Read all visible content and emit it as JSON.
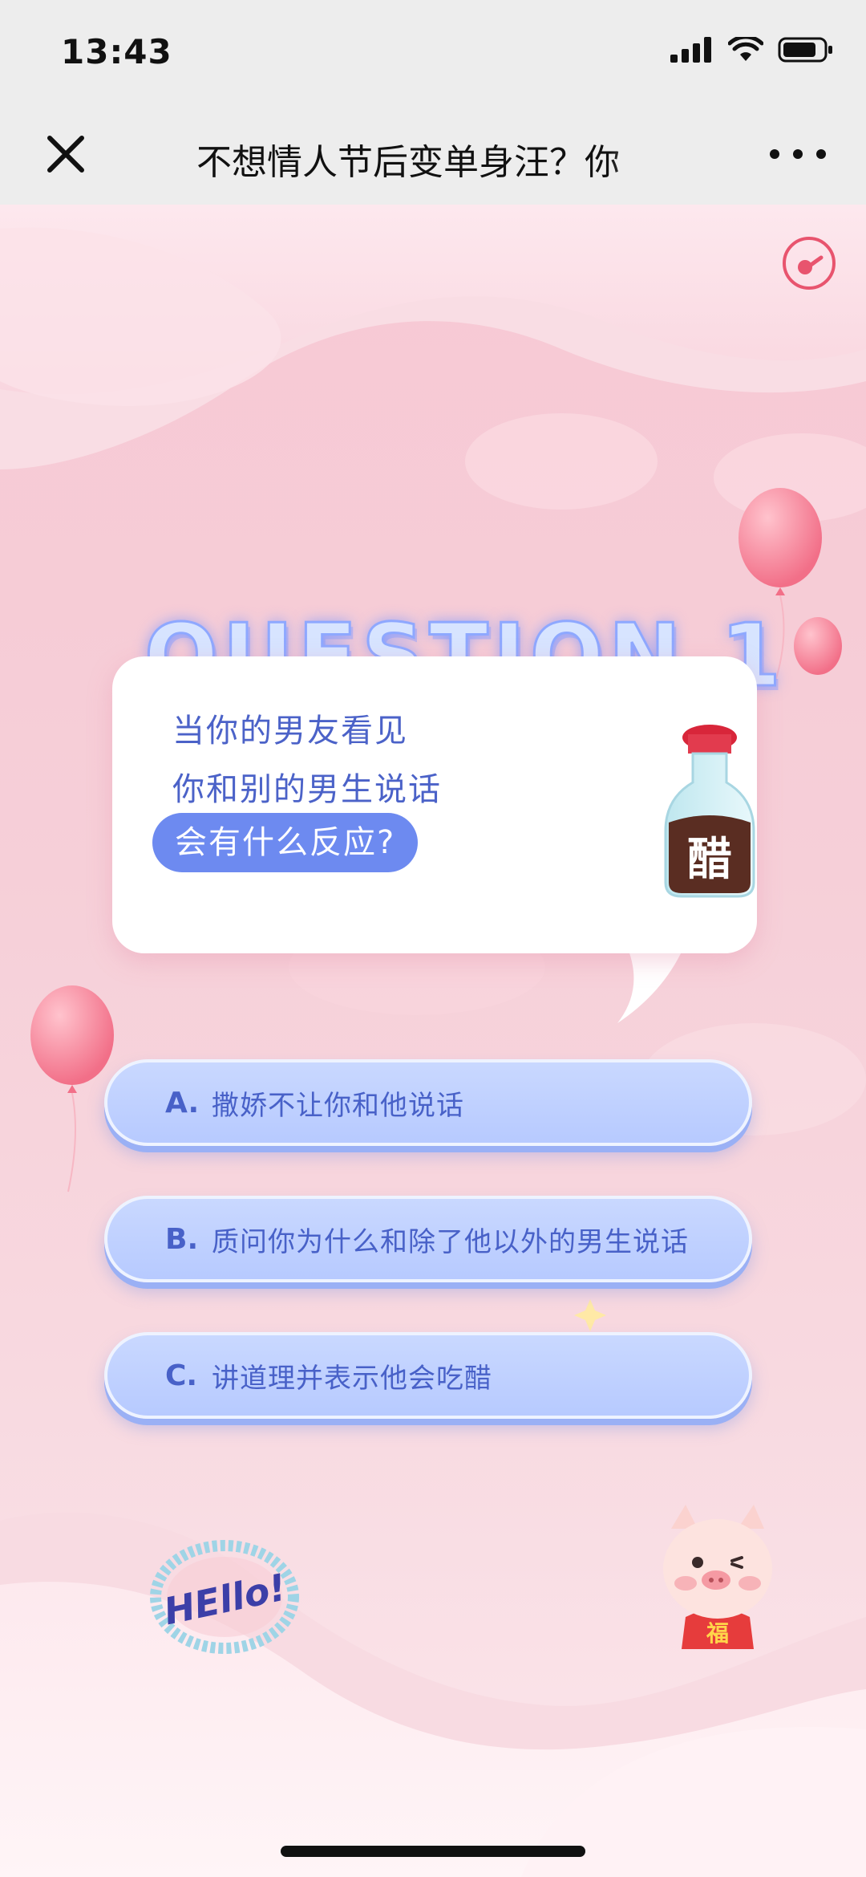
{
  "status_bar": {
    "time": "13:43"
  },
  "nav": {
    "title": "不想情人节后变单身汪？你"
  },
  "quiz": {
    "title": "QUESTION 1",
    "question_lines": [
      "当你的男友看见",
      "你和别的男生说话"
    ],
    "question_highlight": "会有什么反应?",
    "bottle_label": "醋",
    "options": [
      {
        "letter": "A.",
        "text": "撒娇不让你和他说话"
      },
      {
        "letter": "B.",
        "text": "质问你为什么和除了他以外的男生说话"
      },
      {
        "letter": "C.",
        "text": "讲道理并表示他会吃醋"
      }
    ]
  },
  "decor": {
    "hello_text": "HEllo!",
    "pig_badge": "福"
  },
  "colors": {
    "accent": "#4b62c8",
    "highlight": "#6d8af0",
    "background": "#f7c8d4",
    "option_bg": "#c0d1ff",
    "music": "#e8546e"
  }
}
